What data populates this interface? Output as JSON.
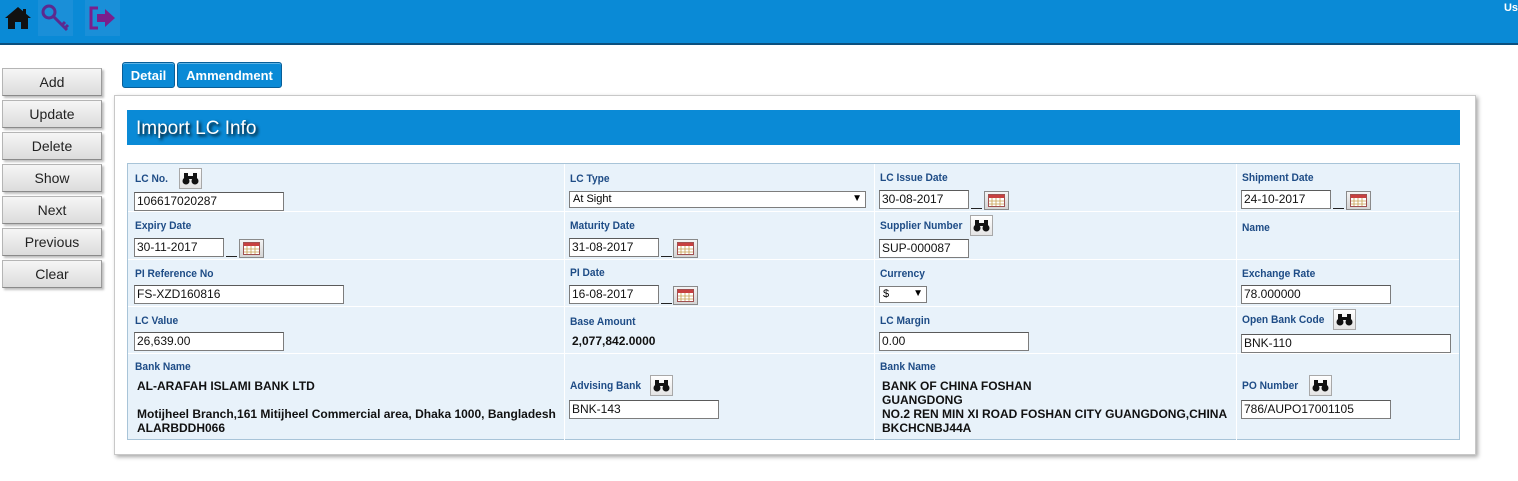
{
  "topbar": {
    "user_label": "Us",
    "icons": [
      "home-icon",
      "key-icon",
      "logout-icon"
    ]
  },
  "sidebar": {
    "buttons": [
      "Add",
      "Update",
      "Delete",
      "Show",
      "Next",
      "Previous",
      "Clear"
    ]
  },
  "tabs": [
    "Detail",
    "Ammendment"
  ],
  "panel": {
    "title": "Import LC Info"
  },
  "form": {
    "lc_no": {
      "label": "LC No.",
      "value": "106617020287"
    },
    "lc_type": {
      "label": "LC Type",
      "value": "At Sight"
    },
    "lc_issue_date": {
      "label": "LC Issue Date",
      "value": "30-08-2017"
    },
    "shipment_date": {
      "label": "Shipment Date",
      "value": "24-10-2017"
    },
    "expiry_date": {
      "label": "Expiry Date",
      "value": "30-11-2017"
    },
    "maturity_date": {
      "label": "Maturity Date",
      "value": "31-08-2017"
    },
    "supplier_number": {
      "label": "Supplier Number",
      "value": "SUP-000087"
    },
    "name": {
      "label": "Name"
    },
    "pi_reference_no": {
      "label": "PI Reference No",
      "value": "FS-XZD160816"
    },
    "pi_date": {
      "label": "PI Date",
      "value": "16-08-2017"
    },
    "currency": {
      "label": "Currency",
      "value": "$"
    },
    "exchange_rate": {
      "label": "Exchange Rate",
      "value": "78.000000"
    },
    "lc_value": {
      "label": "LC Value",
      "value": "26,639.00"
    },
    "base_amount": {
      "label": "Base Amount",
      "value": "2,077,842.0000"
    },
    "lc_margin": {
      "label": "LC Margin",
      "value": "0.00"
    },
    "open_bank_code": {
      "label": "Open Bank Code",
      "value": "BNK-110"
    },
    "open_bank": {
      "label": "Bank Name",
      "name": "AL-ARAFAH ISLAMI BANK LTD",
      "address": "Motijheel Branch,161 Mitijheel Commercial area, Dhaka 1000, Bangladesh",
      "swift": "ALARBDDH066"
    },
    "advising_bank": {
      "label": "Advising Bank",
      "value": "BNK-143"
    },
    "advising_bank_info": {
      "label": "Bank Name",
      "name": "BANK OF CHINA FOSHAN",
      "line2": "GUANGDONG",
      "address": "NO.2 REN MIN XI ROAD FOSHAN CITY GUANGDONG,CHINA",
      "swift": "BKCHCNBJ44A"
    },
    "po_number": {
      "label": "PO Number",
      "value": "786/AUPO17001105"
    }
  }
}
